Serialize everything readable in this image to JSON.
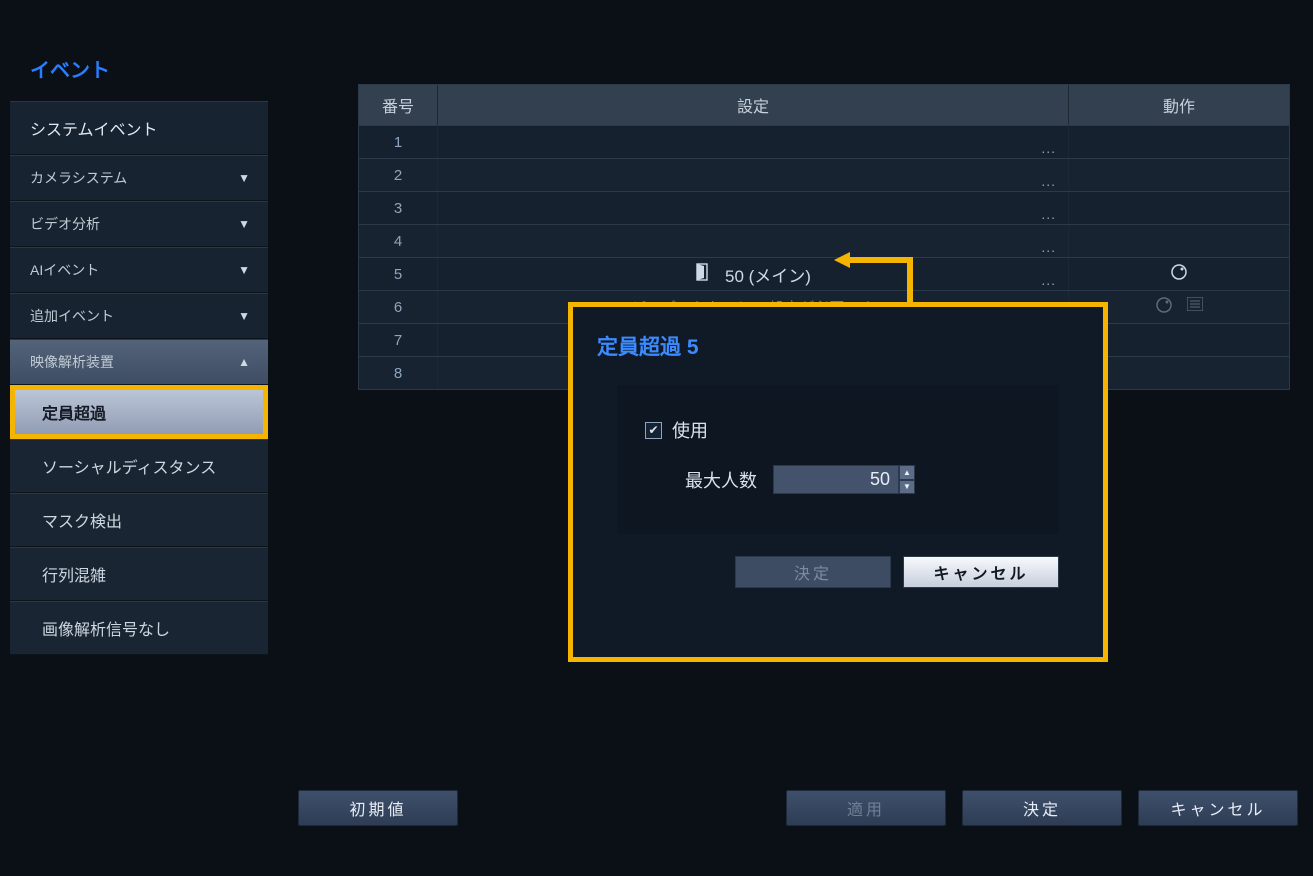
{
  "sidebar": {
    "title": "イベント",
    "system_event": "システムイベント",
    "camera_system": "カメラシステム",
    "video_analysis": "ビデオ分析",
    "ai_event": "AIイベント",
    "extra_event": "追加イベント",
    "group_label": "映像解析装置",
    "subs": {
      "capacity": "定員超過",
      "social": "ソーシャルディスタンス",
      "mask": "マスク検出",
      "queue": "行列混雑",
      "nosignal": "画像解析信号なし"
    }
  },
  "table": {
    "headers": {
      "num": "番号",
      "setting": "設定",
      "action": "動作"
    },
    "rows": {
      "r1": "1",
      "r2": "2",
      "r3": "3",
      "r4": "4",
      "r5": "5",
      "r5_set": "50 (メイン)",
      "r6": "6",
      "r6_set": "ピープルカウント の設定が必要です",
      "r7": "7",
      "r8": "8"
    }
  },
  "popup": {
    "title": "定員超過 5",
    "use_label": "使用",
    "max_label": "最大人数",
    "max_value": "50",
    "ok": "決定",
    "cancel": "キャンセル"
  },
  "footer": {
    "reset": "初期値",
    "apply": "適用",
    "ok": "決定",
    "cancel": "キャンセル"
  }
}
